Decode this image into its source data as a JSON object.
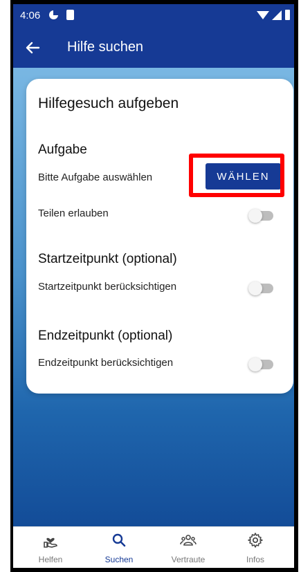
{
  "status_bar": {
    "time": "4:06"
  },
  "app_bar": {
    "title": "Hilfe suchen"
  },
  "card": {
    "title": "Hilfegesuch aufgeben",
    "task_section": {
      "title": "Aufgabe",
      "select_label": "Bitte Aufgabe auswählen",
      "select_button": "WÄHLEN",
      "share_label": "Teilen erlauben",
      "share_enabled": false
    },
    "start_section": {
      "title": "Startzeitpunkt (optional)",
      "toggle_label": "Startzeitpunkt berücksichtigen",
      "enabled": false
    },
    "end_section": {
      "title": "Endzeitpunkt (optional)",
      "toggle_label": "Endzeitpunkt berücksichtigen",
      "enabled": false
    }
  },
  "bottom_nav": {
    "items": [
      {
        "label": "Helfen",
        "icon": "helping-hand-icon",
        "active": false
      },
      {
        "label": "Suchen",
        "icon": "search-icon",
        "active": true
      },
      {
        "label": "Vertraute",
        "icon": "people-icon",
        "active": false
      },
      {
        "label": "Infos",
        "icon": "gear-icon",
        "active": false
      }
    ]
  },
  "colors": {
    "primary": "#163a95",
    "highlight": "#ff0000",
    "toggle_off": "#bdbdbd"
  }
}
